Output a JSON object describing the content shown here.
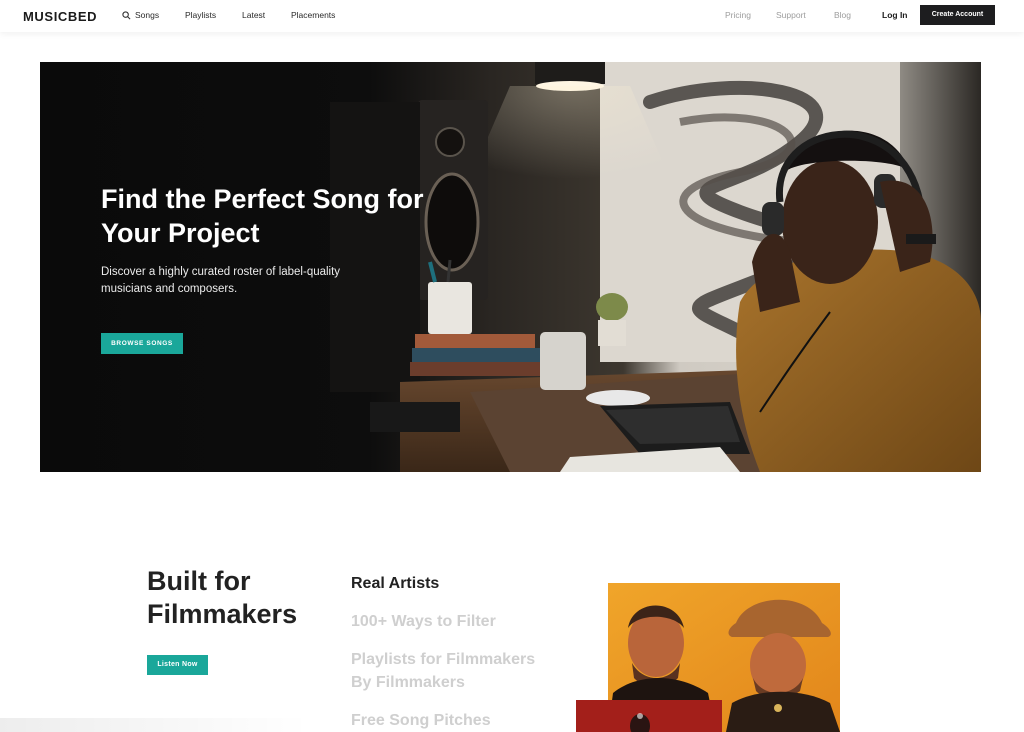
{
  "nav": {
    "logo": "MUSICBED",
    "songs": "Songs",
    "playlists": "Playlists",
    "latest": "Latest",
    "placements": "Placements",
    "pricing": "Pricing",
    "support": "Support",
    "blog": "Blog",
    "login": "Log In",
    "create_account": "Create Account"
  },
  "hero": {
    "title": "Find the Perfect Song for Your Project",
    "subtitle": "Discover a highly curated roster of label-quality musicians and composers.",
    "button": "BROWSE SONGS"
  },
  "section": {
    "title": "Built for Filmmakers",
    "button": "Listen Now",
    "features": [
      "Real Artists",
      "100+ Ways to Filter",
      "Playlists for Filmmakers By Filmmakers",
      "Free Song Pitches"
    ]
  },
  "colors": {
    "accent": "#1aa79a",
    "dark_button": "#1d1d1f",
    "muted_text": "#cfcfcf"
  }
}
